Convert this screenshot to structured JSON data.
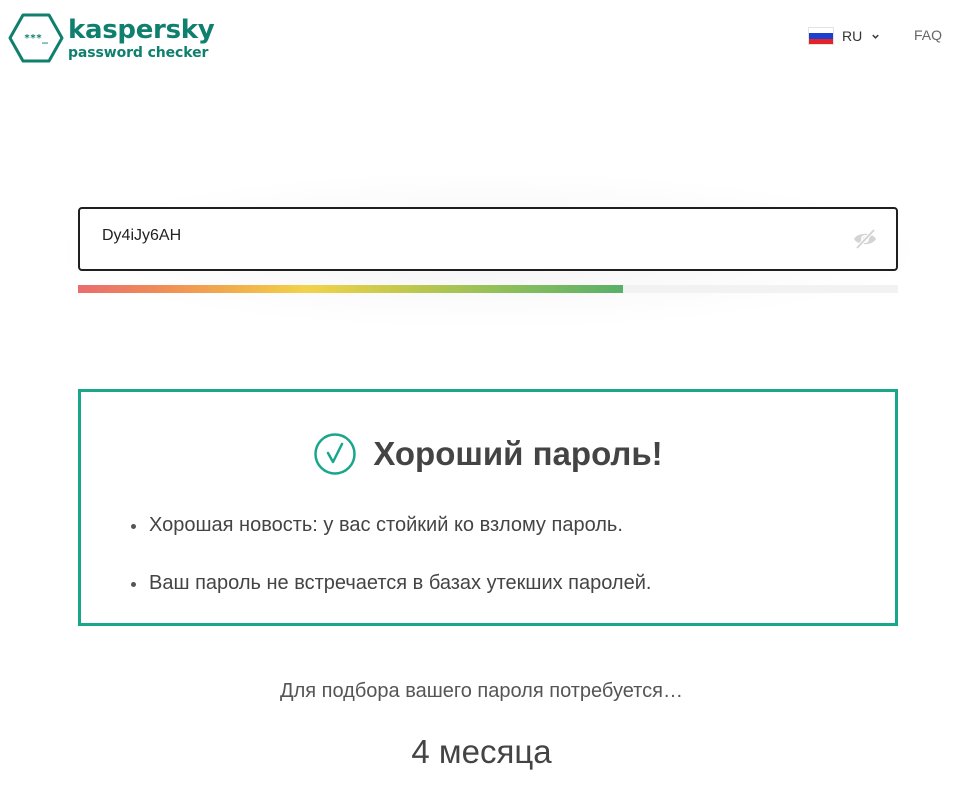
{
  "header": {
    "logo_icon": "password-dots-hexagon-icon",
    "brand": "kaspersky",
    "product": "password checker",
    "language": {
      "code": "RU",
      "flag_icon": "russia-flag-icon",
      "flag_colors": [
        "#ffffff",
        "#1c3fd0",
        "#e3232a"
      ]
    },
    "faq_label": "FAQ"
  },
  "password": {
    "value": "Dy4iJy6AH",
    "toggle_icon": "eye-hidden-icon",
    "strength_fraction": 0.665
  },
  "result": {
    "icon": "check-circle-icon",
    "title": "Хороший пароль!",
    "bullets": [
      "Хорошая новость: у вас стойкий ко взлому пароль.",
      "Ваш пароль не встречается в базах утекших паролей."
    ]
  },
  "crack_time": {
    "label": "Для подбора вашего пароля потребуется…",
    "value": "4 месяца"
  },
  "colors": {
    "brand_green": "#0f7f6e",
    "card_border": "#1aa58d"
  }
}
